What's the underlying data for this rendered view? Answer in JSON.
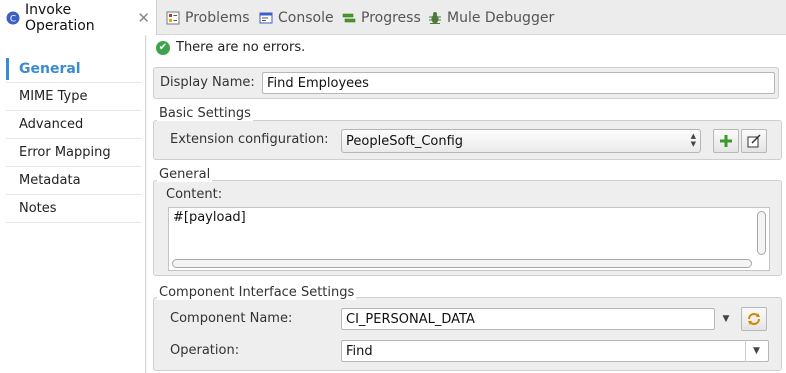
{
  "tabs": [
    {
      "label": "Invoke Operation",
      "icon": "mule-operation-icon",
      "active": true
    },
    {
      "label": "Problems",
      "icon": "problems-icon"
    },
    {
      "label": "Console",
      "icon": "console-icon"
    },
    {
      "label": "Progress",
      "icon": "progress-icon"
    },
    {
      "label": "Mule Debugger",
      "icon": "debugger-icon"
    }
  ],
  "sidebar": {
    "items": [
      {
        "label": "General",
        "active": true
      },
      {
        "label": "MIME Type"
      },
      {
        "label": "Advanced"
      },
      {
        "label": "Error Mapping"
      },
      {
        "label": "Metadata"
      },
      {
        "label": "Notes"
      }
    ]
  },
  "status": {
    "message": "There are no errors."
  },
  "display_name": {
    "label": "Display Name:",
    "value": "Find Employees"
  },
  "basic_settings": {
    "legend": "Basic Settings",
    "extension_label": "Extension configuration:",
    "extension_value": "PeopleSoft_Config"
  },
  "general": {
    "legend": "General",
    "content_label": "Content:",
    "content_value": "#[payload]"
  },
  "component_interface": {
    "legend": "Component Interface Settings",
    "component_label": "Component Name:",
    "component_value": "CI_PERSONAL_DATA",
    "operation_label": "Operation:",
    "operation_value": "Find"
  },
  "colors": {
    "accent": "#3a8bd1",
    "success": "#3fa34d"
  }
}
